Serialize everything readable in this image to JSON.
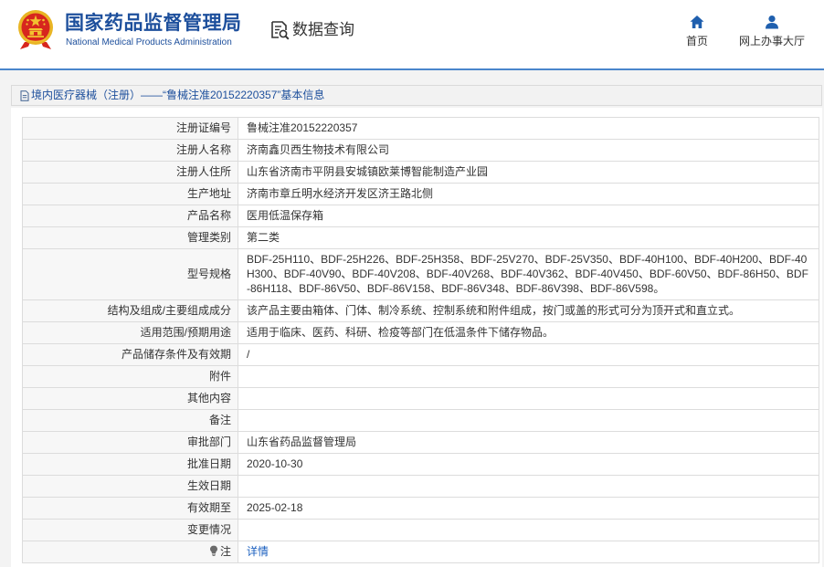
{
  "header": {
    "logo_icon": "national-emblem-icon",
    "logo_title": "国家药品监督管理局",
    "logo_subtitle": "National Medical Products Administration",
    "data_query": {
      "icon": "document-search-icon",
      "label": "数据查询"
    },
    "nav": [
      {
        "icon": "home-icon",
        "label": "首页"
      },
      {
        "icon": "user-icon",
        "label": "网上办事大厅"
      }
    ]
  },
  "breadcrumb": {
    "icon": "document-icon",
    "text": "境内医疗器械（注册）——“鲁械注准20152220357”基本信息"
  },
  "detail_table": {
    "rows": [
      {
        "label": "注册证编号",
        "value": "鲁械注准20152220357"
      },
      {
        "label": "注册人名称",
        "value": "济南鑫贝西生物技术有限公司"
      },
      {
        "label": "注册人住所",
        "value": "山东省济南市平阴县安城镇欧莱博智能制造产业园"
      },
      {
        "label": "生产地址",
        "value": "济南市章丘明水经济开发区济王路北侧"
      },
      {
        "label": "产品名称",
        "value": "医用低温保存箱"
      },
      {
        "label": "管理类别",
        "value": "第二类"
      },
      {
        "label": "型号规格",
        "value": "BDF-25H110、BDF-25H226、BDF-25H358、BDF-25V270、BDF-25V350、BDF-40H100、BDF-40H200、BDF-40H300、BDF-40V90、BDF-40V208、BDF-40V268、BDF-40V362、BDF-40V450、BDF-60V50、BDF-86H50、BDF-86H118、BDF-86V50、BDF-86V158、BDF-86V348、BDF-86V398、BDF-86V598。"
      },
      {
        "label": "结构及组成/主要组成成分",
        "value": "该产品主要由箱体、门体、制冷系统、控制系统和附件组成，按门或盖的形式可分为顶开式和直立式。"
      },
      {
        "label": "适用范围/预期用途",
        "value": "适用于临床、医药、科研、检疫等部门在低温条件下储存物品。"
      },
      {
        "label": "产品储存条件及有效期",
        "value": "/"
      },
      {
        "label": "附件",
        "value": ""
      },
      {
        "label": "其他内容",
        "value": ""
      },
      {
        "label": "备注",
        "value": ""
      },
      {
        "label": "审批部门",
        "value": "山东省药品监督管理局"
      },
      {
        "label": "批准日期",
        "value": "2020-10-30"
      },
      {
        "label": "生效日期",
        "value": ""
      },
      {
        "label": "有效期至",
        "value": "2025-02-18"
      },
      {
        "label": "变更情况",
        "value": ""
      },
      {
        "label": "注",
        "value": "详情",
        "icon": "lightbulb-icon"
      }
    ]
  },
  "colors": {
    "brand_blue": "#1d4f9c",
    "header_line": "#4a85cc",
    "icon_blue": "#1f5fae",
    "link": "#1a5fbf",
    "emblem_red": "#d7261e",
    "emblem_gold": "#f2c230"
  }
}
